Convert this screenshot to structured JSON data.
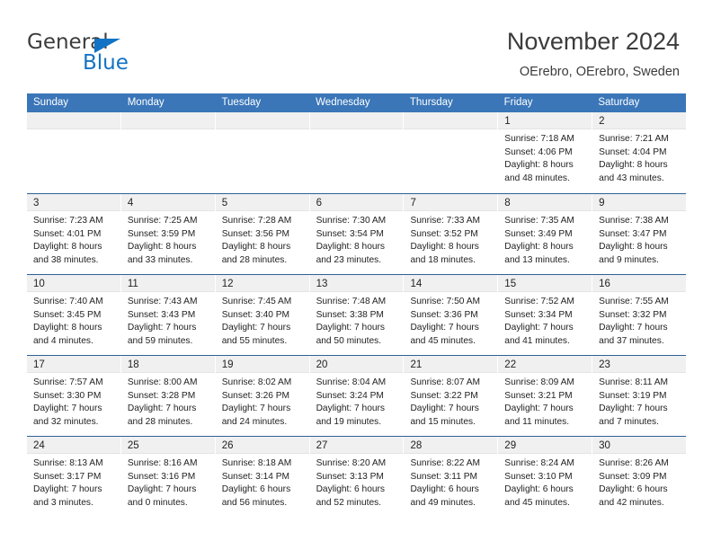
{
  "brand": {
    "name_part1": "General",
    "name_part2": "Blue",
    "triangle_color": "#1273c4"
  },
  "header": {
    "title": "November 2024",
    "subtitle": "OErebro, OErebro, Sweden",
    "accent_color": "#3a76b8"
  },
  "calendar": {
    "weekdays": [
      "Sunday",
      "Monday",
      "Tuesday",
      "Wednesday",
      "Thursday",
      "Friday",
      "Saturday"
    ],
    "weeks": [
      [
        {
          "day": "",
          "lines": []
        },
        {
          "day": "",
          "lines": []
        },
        {
          "day": "",
          "lines": []
        },
        {
          "day": "",
          "lines": []
        },
        {
          "day": "",
          "lines": []
        },
        {
          "day": "1",
          "lines": [
            "Sunrise: 7:18 AM",
            "Sunset: 4:06 PM",
            "Daylight: 8 hours",
            "and 48 minutes."
          ]
        },
        {
          "day": "2",
          "lines": [
            "Sunrise: 7:21 AM",
            "Sunset: 4:04 PM",
            "Daylight: 8 hours",
            "and 43 minutes."
          ]
        }
      ],
      [
        {
          "day": "3",
          "lines": [
            "Sunrise: 7:23 AM",
            "Sunset: 4:01 PM",
            "Daylight: 8 hours",
            "and 38 minutes."
          ]
        },
        {
          "day": "4",
          "lines": [
            "Sunrise: 7:25 AM",
            "Sunset: 3:59 PM",
            "Daylight: 8 hours",
            "and 33 minutes."
          ]
        },
        {
          "day": "5",
          "lines": [
            "Sunrise: 7:28 AM",
            "Sunset: 3:56 PM",
            "Daylight: 8 hours",
            "and 28 minutes."
          ]
        },
        {
          "day": "6",
          "lines": [
            "Sunrise: 7:30 AM",
            "Sunset: 3:54 PM",
            "Daylight: 8 hours",
            "and 23 minutes."
          ]
        },
        {
          "day": "7",
          "lines": [
            "Sunrise: 7:33 AM",
            "Sunset: 3:52 PM",
            "Daylight: 8 hours",
            "and 18 minutes."
          ]
        },
        {
          "day": "8",
          "lines": [
            "Sunrise: 7:35 AM",
            "Sunset: 3:49 PM",
            "Daylight: 8 hours",
            "and 13 minutes."
          ]
        },
        {
          "day": "9",
          "lines": [
            "Sunrise: 7:38 AM",
            "Sunset: 3:47 PM",
            "Daylight: 8 hours",
            "and 9 minutes."
          ]
        }
      ],
      [
        {
          "day": "10",
          "lines": [
            "Sunrise: 7:40 AM",
            "Sunset: 3:45 PM",
            "Daylight: 8 hours",
            "and 4 minutes."
          ]
        },
        {
          "day": "11",
          "lines": [
            "Sunrise: 7:43 AM",
            "Sunset: 3:43 PM",
            "Daylight: 7 hours",
            "and 59 minutes."
          ]
        },
        {
          "day": "12",
          "lines": [
            "Sunrise: 7:45 AM",
            "Sunset: 3:40 PM",
            "Daylight: 7 hours",
            "and 55 minutes."
          ]
        },
        {
          "day": "13",
          "lines": [
            "Sunrise: 7:48 AM",
            "Sunset: 3:38 PM",
            "Daylight: 7 hours",
            "and 50 minutes."
          ]
        },
        {
          "day": "14",
          "lines": [
            "Sunrise: 7:50 AM",
            "Sunset: 3:36 PM",
            "Daylight: 7 hours",
            "and 45 minutes."
          ]
        },
        {
          "day": "15",
          "lines": [
            "Sunrise: 7:52 AM",
            "Sunset: 3:34 PM",
            "Daylight: 7 hours",
            "and 41 minutes."
          ]
        },
        {
          "day": "16",
          "lines": [
            "Sunrise: 7:55 AM",
            "Sunset: 3:32 PM",
            "Daylight: 7 hours",
            "and 37 minutes."
          ]
        }
      ],
      [
        {
          "day": "17",
          "lines": [
            "Sunrise: 7:57 AM",
            "Sunset: 3:30 PM",
            "Daylight: 7 hours",
            "and 32 minutes."
          ]
        },
        {
          "day": "18",
          "lines": [
            "Sunrise: 8:00 AM",
            "Sunset: 3:28 PM",
            "Daylight: 7 hours",
            "and 28 minutes."
          ]
        },
        {
          "day": "19",
          "lines": [
            "Sunrise: 8:02 AM",
            "Sunset: 3:26 PM",
            "Daylight: 7 hours",
            "and 24 minutes."
          ]
        },
        {
          "day": "20",
          "lines": [
            "Sunrise: 8:04 AM",
            "Sunset: 3:24 PM",
            "Daylight: 7 hours",
            "and 19 minutes."
          ]
        },
        {
          "day": "21",
          "lines": [
            "Sunrise: 8:07 AM",
            "Sunset: 3:22 PM",
            "Daylight: 7 hours",
            "and 15 minutes."
          ]
        },
        {
          "day": "22",
          "lines": [
            "Sunrise: 8:09 AM",
            "Sunset: 3:21 PM",
            "Daylight: 7 hours",
            "and 11 minutes."
          ]
        },
        {
          "day": "23",
          "lines": [
            "Sunrise: 8:11 AM",
            "Sunset: 3:19 PM",
            "Daylight: 7 hours",
            "and 7 minutes."
          ]
        }
      ],
      [
        {
          "day": "24",
          "lines": [
            "Sunrise: 8:13 AM",
            "Sunset: 3:17 PM",
            "Daylight: 7 hours",
            "and 3 minutes."
          ]
        },
        {
          "day": "25",
          "lines": [
            "Sunrise: 8:16 AM",
            "Sunset: 3:16 PM",
            "Daylight: 7 hours",
            "and 0 minutes."
          ]
        },
        {
          "day": "26",
          "lines": [
            "Sunrise: 8:18 AM",
            "Sunset: 3:14 PM",
            "Daylight: 6 hours",
            "and 56 minutes."
          ]
        },
        {
          "day": "27",
          "lines": [
            "Sunrise: 8:20 AM",
            "Sunset: 3:13 PM",
            "Daylight: 6 hours",
            "and 52 minutes."
          ]
        },
        {
          "day": "28",
          "lines": [
            "Sunrise: 8:22 AM",
            "Sunset: 3:11 PM",
            "Daylight: 6 hours",
            "and 49 minutes."
          ]
        },
        {
          "day": "29",
          "lines": [
            "Sunrise: 8:24 AM",
            "Sunset: 3:10 PM",
            "Daylight: 6 hours",
            "and 45 minutes."
          ]
        },
        {
          "day": "30",
          "lines": [
            "Sunrise: 8:26 AM",
            "Sunset: 3:09 PM",
            "Daylight: 6 hours",
            "and 42 minutes."
          ]
        }
      ]
    ]
  }
}
